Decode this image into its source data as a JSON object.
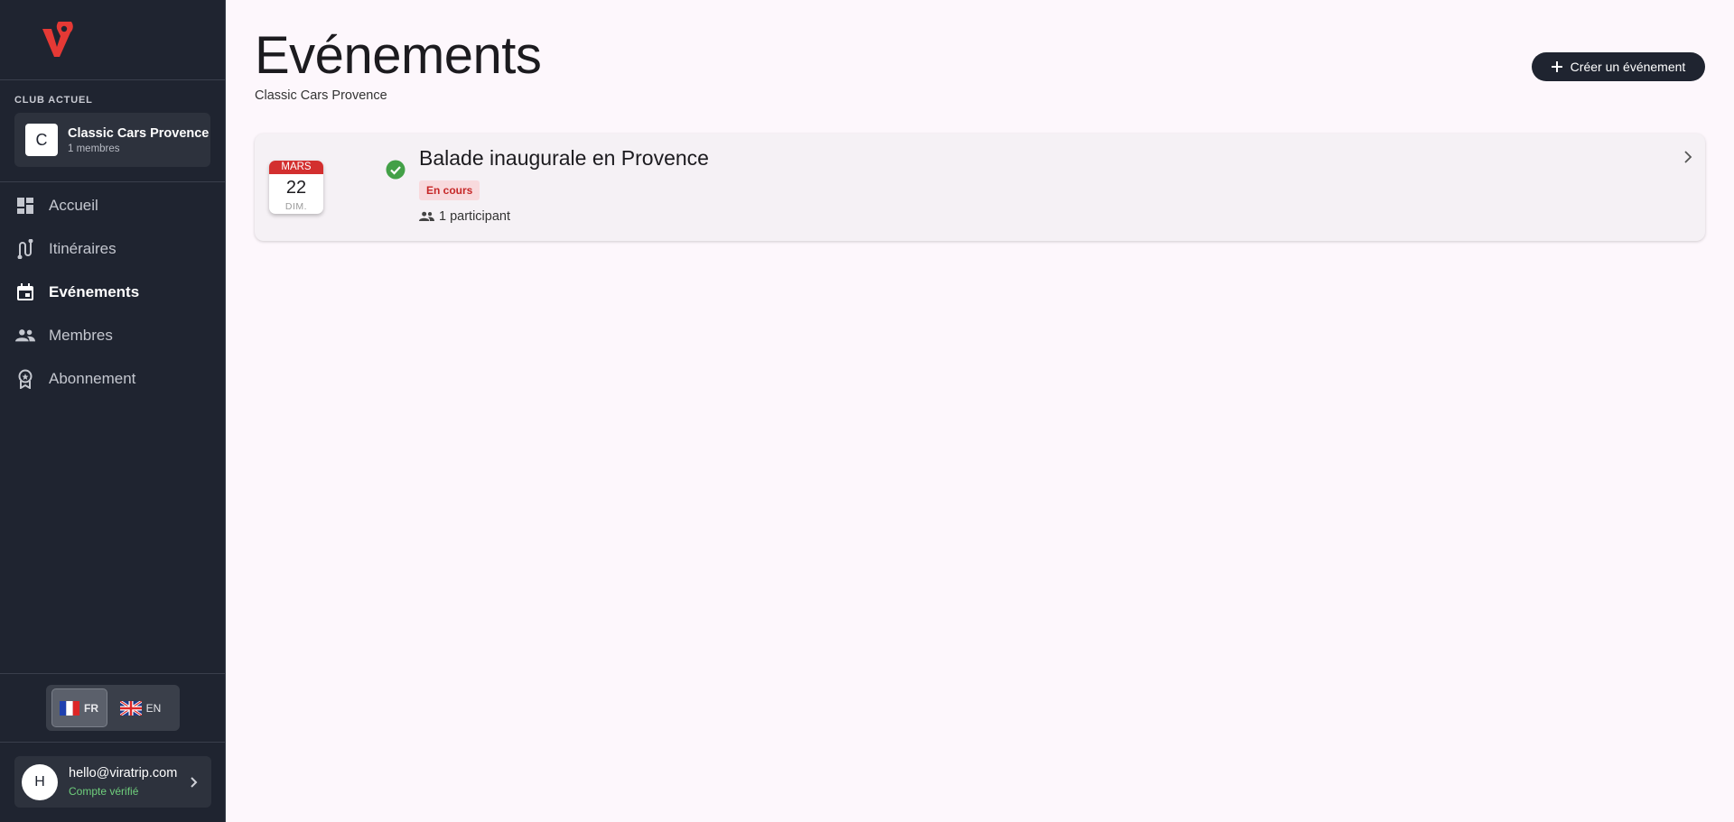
{
  "sidebar": {
    "club_caption": "CLUB ACTUEL",
    "club": {
      "initial": "C",
      "name": "Classic Cars Provence",
      "members": "1 membres"
    },
    "nav": [
      {
        "label": "Accueil",
        "icon": "dashboard-icon",
        "active": false
      },
      {
        "label": "Itinéraires",
        "icon": "route-icon",
        "active": false
      },
      {
        "label": "Evénements",
        "icon": "calendar-icon",
        "active": true
      },
      {
        "label": "Membres",
        "icon": "people-icon",
        "active": false
      },
      {
        "label": "Abonnement",
        "icon": "badge-icon",
        "active": false
      }
    ],
    "languages": [
      {
        "code": "FR",
        "flag": "france-flag-icon",
        "active": true
      },
      {
        "code": "EN",
        "flag": "uk-flag-icon",
        "active": false
      }
    ],
    "user": {
      "initial": "H",
      "email": "hello@viratrip.com",
      "status": "Compte vérifié"
    }
  },
  "header": {
    "title": "Evénements",
    "subtitle": "Classic Cars Provence",
    "create_label": "Créer un événement"
  },
  "events": [
    {
      "month": "MARS",
      "day": "22",
      "weekday": "DIM.",
      "title": "Balade inaugurale en Provence",
      "status": "En cours",
      "participants": "1 participant"
    }
  ],
  "colors": {
    "sidebar_bg": "#1f2430",
    "accent_red": "#d32f2f",
    "status_green": "#43a047",
    "verified_green": "#6fcf7c",
    "page_bg": "#fdf7fc"
  }
}
